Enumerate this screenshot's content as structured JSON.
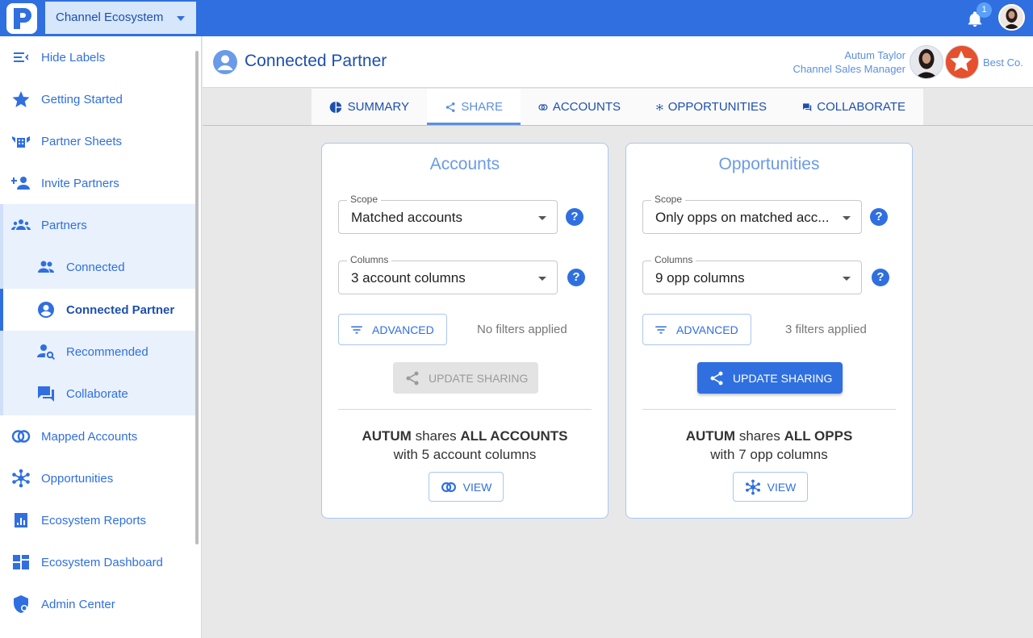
{
  "topbar": {
    "ecosystem_label": "Channel Ecosystem",
    "notification_count": "1"
  },
  "sidebar": {
    "hide_labels": "Hide Labels",
    "getting_started": "Getting Started",
    "partner_sheets": "Partner Sheets",
    "invite_partners": "Invite Partners",
    "partners": "Partners",
    "connected": "Connected",
    "connected_partner": "Connected Partner",
    "recommended": "Recommended",
    "collaborate": "Collaborate",
    "mapped_accounts": "Mapped Accounts",
    "opportunities": "Opportunities",
    "ecosystem_reports": "Ecosystem Reports",
    "ecosystem_dashboard": "Ecosystem Dashboard",
    "admin_center": "Admin Center"
  },
  "header": {
    "title": "Connected Partner",
    "user_name": "Autum Taylor",
    "user_role": "Channel Sales Manager",
    "company_name": "Best Co."
  },
  "tabs": {
    "summary": "SUMMARY",
    "share": "SHARE",
    "accounts": "ACCOUNTS",
    "opportunities": "OPPORTUNITIES",
    "collaborate": "COLLABORATE"
  },
  "accounts_card": {
    "title": "Accounts",
    "scope_label": "Scope",
    "scope_value": "Matched accounts",
    "columns_label": "Columns",
    "columns_value": "3 account columns",
    "advanced_label": "ADVANCED",
    "filters_text": "No filters applied",
    "update_label": "UPDATE SHARING",
    "summary_name": "AUTUM",
    "summary_verb": "shares",
    "summary_what": "ALL ACCOUNTS",
    "summary_line2": "with 5 account columns",
    "view_label": "VIEW"
  },
  "opps_card": {
    "title": "Opportunities",
    "scope_label": "Scope",
    "scope_value": "Only opps on matched acc...",
    "columns_label": "Columns",
    "columns_value": "9 opp columns",
    "advanced_label": "ADVANCED",
    "filters_text": "3 filters applied",
    "update_label": "UPDATE SHARING",
    "summary_name": "AUTUM",
    "summary_verb": "shares",
    "summary_what": "ALL OPPS",
    "summary_line2": "with 7 opp columns",
    "view_label": "VIEW"
  },
  "colors": {
    "brand_blue": "#2f6fe0",
    "dark_blue": "#1d4fae",
    "light_blue": "#6a9be8",
    "background": "#e8e8e8"
  },
  "icons": [
    "logo-icon",
    "bell-icon",
    "hide-labels-icon",
    "star-icon",
    "partner-sheets-icon",
    "invite-icon",
    "partners-icon",
    "connected-icon",
    "account-circle-icon",
    "recommended-icon",
    "chat-icon",
    "venn-icon",
    "hub-icon",
    "report-icon",
    "dashboard-icon",
    "shield-icon",
    "pie-icon",
    "share-icon",
    "filter-icon"
  ]
}
